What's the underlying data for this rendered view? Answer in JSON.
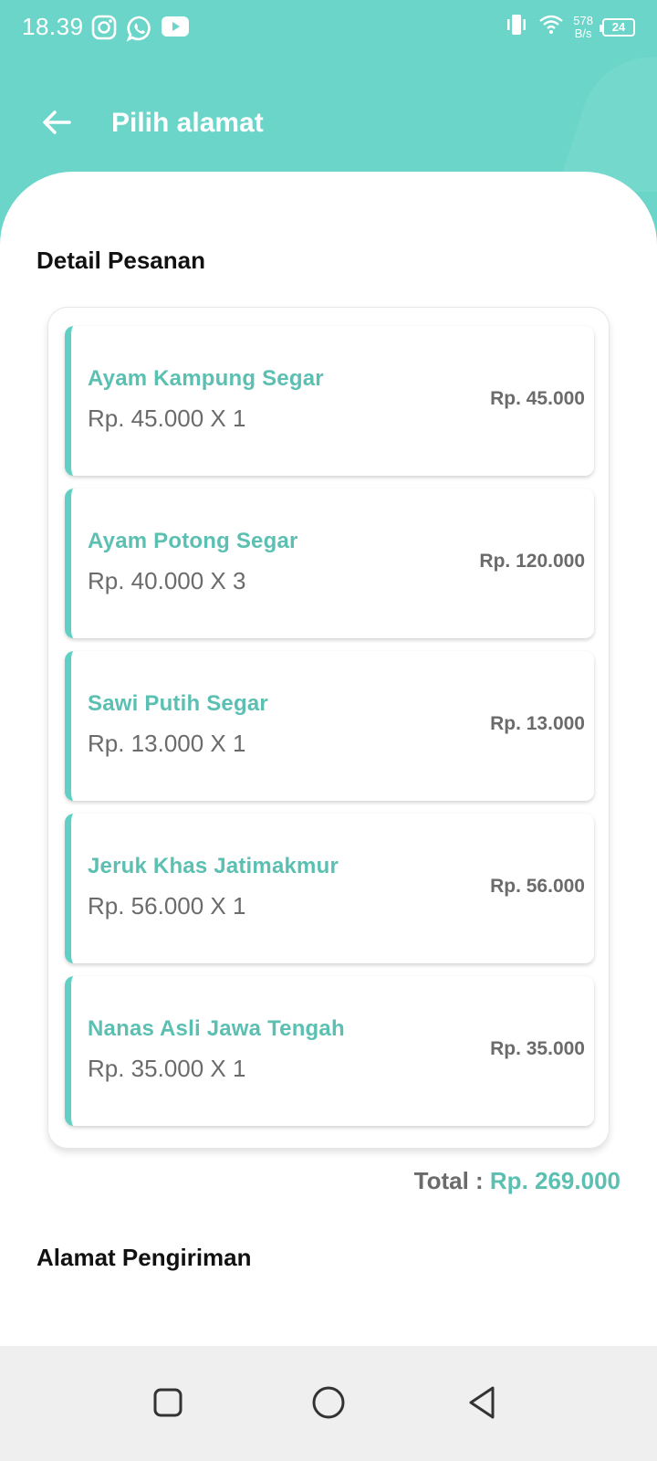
{
  "status_bar": {
    "time": "18.39",
    "net_speed_value": "578",
    "net_speed_unit": "B/s",
    "battery": "24",
    "icons": [
      "instagram-icon",
      "whatsapp-icon",
      "youtube-icon",
      "vibrate-icon",
      "wifi-icon",
      "battery-icon"
    ]
  },
  "appbar": {
    "title": "Pilih alamat",
    "back_icon": "arrow-left-icon"
  },
  "order_section": {
    "title": "Detail Pesanan",
    "items": [
      {
        "name": "Ayam Kampung Segar",
        "qty_line": "Rp. 45.000 X 1",
        "subtotal": "Rp. 45.000"
      },
      {
        "name": "Ayam Potong Segar",
        "qty_line": "Rp. 40.000 X 3",
        "subtotal": "Rp. 120.000"
      },
      {
        "name": "Sawi Putih Segar",
        "qty_line": "Rp. 13.000 X 1",
        "subtotal": "Rp. 13.000"
      },
      {
        "name": "Jeruk Khas Jatimakmur",
        "qty_line": "Rp. 56.000 X 1",
        "subtotal": "Rp. 56.000"
      },
      {
        "name": "Nanas Asli Jawa Tengah",
        "qty_line": "Rp. 35.000 X 1",
        "subtotal": "Rp. 35.000"
      }
    ],
    "total_label": "Total : ",
    "total_value": "Rp. 269.000"
  },
  "address_section": {
    "title": "Alamat Pengiriman"
  },
  "colors": {
    "accent": "#6ad5c8",
    "item_name": "#5bbfb2",
    "text_gray": "#6b6b6b"
  },
  "nav_bar": {
    "icons": [
      "recent-apps-icon",
      "home-icon",
      "back-icon"
    ]
  }
}
